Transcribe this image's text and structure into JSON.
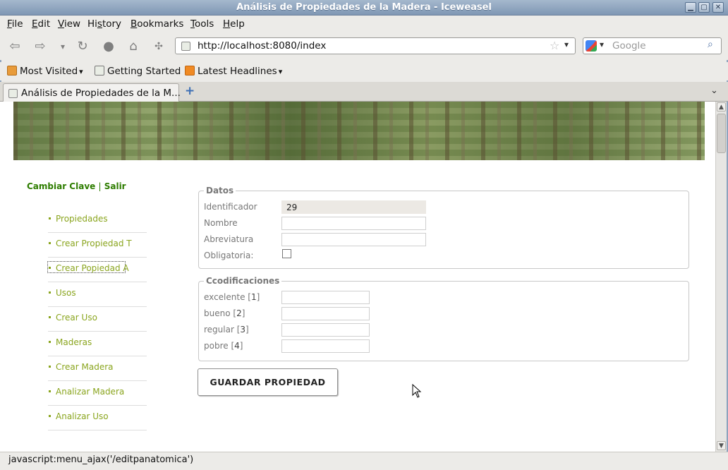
{
  "window": {
    "title": "Análisis de Propiedades de la Madera - Iceweasel"
  },
  "menubar": [
    "File",
    "Edit",
    "View",
    "History",
    "Bookmarks",
    "Tools",
    "Help"
  ],
  "menu_underline": [
    "F",
    "E",
    "V",
    "s",
    "B",
    "T",
    "H"
  ],
  "navbar": {
    "url": "http://localhost:8080/index",
    "search_placeholder": "Google"
  },
  "bookmarks": {
    "most_visited": "Most Visited",
    "getting_started": "Getting Started",
    "latest_headlines": "Latest Headlines"
  },
  "tab": {
    "title": "Análisis de Propiedades de la M..."
  },
  "page": {
    "user_links": {
      "change_password": "Cambiar Clave",
      "separator": "|",
      "logout": "Salir"
    },
    "nav": [
      "Propiedades",
      "Crear Propiedad T",
      "Crear Popiedad A",
      "Usos",
      "Crear Uso",
      "Maderas",
      "Crear Madera",
      "Analizar Madera",
      "Analizar Uso"
    ],
    "datos": {
      "legend": "Datos",
      "identificador_label": "Identificador",
      "identificador_value": "29",
      "nombre_label": "Nombre",
      "nombre_value": "",
      "abreviatura_label": "Abreviatura",
      "abreviatura_value": "",
      "obligatoria_label": "Obligatoria:"
    },
    "codificaciones": {
      "legend": "Ccodificaciones",
      "rows": [
        {
          "label": "excelente",
          "code": "1"
        },
        {
          "label": "bueno",
          "code": "2"
        },
        {
          "label": "regular",
          "code": "3"
        },
        {
          "label": "pobre",
          "code": "4"
        }
      ]
    },
    "save_button": "GUARDAR PROPIEDAD"
  },
  "statusbar": {
    "text": "javascript:menu_ajax('/editpanatomica')"
  },
  "colors": {
    "link_green": "#8aa51e",
    "user_link_green": "#2e7d00",
    "titlebar": "#8fa4be"
  }
}
